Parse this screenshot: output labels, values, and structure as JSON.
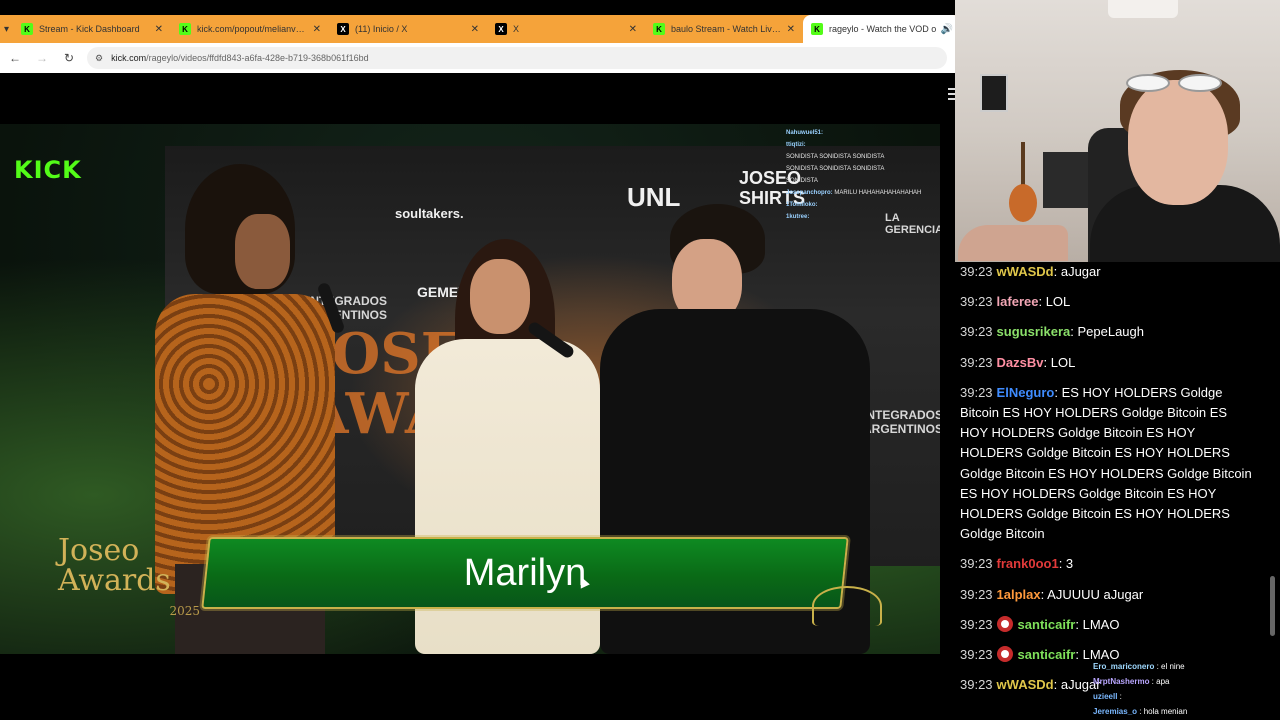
{
  "browser": {
    "tabs": [
      {
        "icon": "kick",
        "title": "Stream - Kick Dashboard",
        "active": false
      },
      {
        "icon": "kick",
        "title": "kick.com/popout/melianvalen/c",
        "active": false
      },
      {
        "icon": "x",
        "title": "(11) Inicio / X",
        "active": false
      },
      {
        "icon": "x",
        "title": "X",
        "active": false
      },
      {
        "icon": "kick",
        "title": "baulo Stream - Watch Live on K",
        "active": false
      },
      {
        "icon": "kick",
        "title": "rageylo - Watch the VOD o",
        "active": true
      }
    ],
    "tab_close_glyph": "✕",
    "url_host": "kick.com",
    "url_path": "/rageylo/videos/ffdfd843-a6fa-428e-b719-368b061f16bd"
  },
  "video": {
    "watermark": "KICK",
    "lower_third_name": "Marilyn",
    "event_logo_line1": "Joseo",
    "event_logo_line2": "Awards",
    "event_logo_year": "2025",
    "backdrop_sponsors": [
      "soultakers.",
      "GEMEYE",
      "INTEGRADOS ARGENTINOS",
      "JOSEO SHIRTS",
      "LA GERENCIA",
      "UNL",
      "INTEGRADOS ARGENTINOS",
      "JOSEO AWARDS"
    ],
    "overlay_chat": [
      {
        "user": "Nahuwuel51:",
        "text": ""
      },
      {
        "user": "ttiqtizi:",
        "text": ""
      },
      {
        "user": "",
        "text": "SONIDISTA SONIDISTA SONIDISTA"
      },
      {
        "user": "",
        "text": "SONIDISTA SONIDISTA SONIDISTA"
      },
      {
        "user": "",
        "text": "SONIDISTA"
      },
      {
        "user": "Josepanchopro:",
        "text": "MARILU HAHAHAHAHAHAHAH"
      },
      {
        "user": "1Tomiloko:",
        "text": ""
      },
      {
        "user": "1kutree:",
        "text": ""
      }
    ]
  },
  "chat": {
    "messages": [
      {
        "time": "39:23",
        "user": "wWASDd",
        "color": "#e0c74a",
        "badge": false,
        "text": "aJugar"
      },
      {
        "time": "39:23",
        "user": "laferee",
        "color": "#f2a6b5",
        "badge": false,
        "text": "LOL"
      },
      {
        "time": "39:23",
        "user": "sugusrikera",
        "color": "#8be06a",
        "badge": false,
        "text": "PepeLaugh"
      },
      {
        "time": "39:23",
        "user": "DazsBv",
        "color": "#ff8fa3",
        "badge": false,
        "text": "LOL"
      },
      {
        "time": "39:23",
        "user": "ElNeguro",
        "color": "#3f8cff",
        "badge": false,
        "text": "ES HOY HOLDERS Goldge Bitcoin ES HOY HOLDERS Goldge Bitcoin ES HOY HOLDERS Goldge Bitcoin ES HOY HOLDERS Goldge Bitcoin ES HOY HOLDERS Goldge Bitcoin ES HOY HOLDERS Goldge Bitcoin ES HOY HOLDERS Goldge Bitcoin ES HOY HOLDERS Goldge Bitcoin ES HOY HOLDERS Goldge Bitcoin"
      },
      {
        "time": "39:23",
        "user": "frank0oo1",
        "color": "#e23a3a",
        "badge": false,
        "text": "3"
      },
      {
        "time": "39:23",
        "user": "1alplax",
        "color": "#ff9a3c",
        "badge": false,
        "text": "AJUUUU aJugar"
      },
      {
        "time": "39:23",
        "user": "santicaifr",
        "color": "#7ee05a",
        "badge": true,
        "text": "LMAO"
      },
      {
        "time": "39:23",
        "user": "santicaifr",
        "color": "#7ee05a",
        "badge": true,
        "text": "LMAO"
      },
      {
        "time": "39:23",
        "user": "wWASDd",
        "color": "#e0c74a",
        "badge": false,
        "text": "aJugar"
      }
    ]
  },
  "mini_chat": [
    {
      "user": "Ero_mariconero",
      "color": "#9fd9ff",
      "text": "el nine"
    },
    {
      "user": "MrptNashermo",
      "color": "#b9a6ff",
      "text": "apa"
    },
    {
      "user": "uzieell",
      "color": "#7ab8ff",
      "text": ""
    },
    {
      "user": "Jeremias_o",
      "color": "#7ab8ff",
      "text": "hola menian"
    }
  ]
}
